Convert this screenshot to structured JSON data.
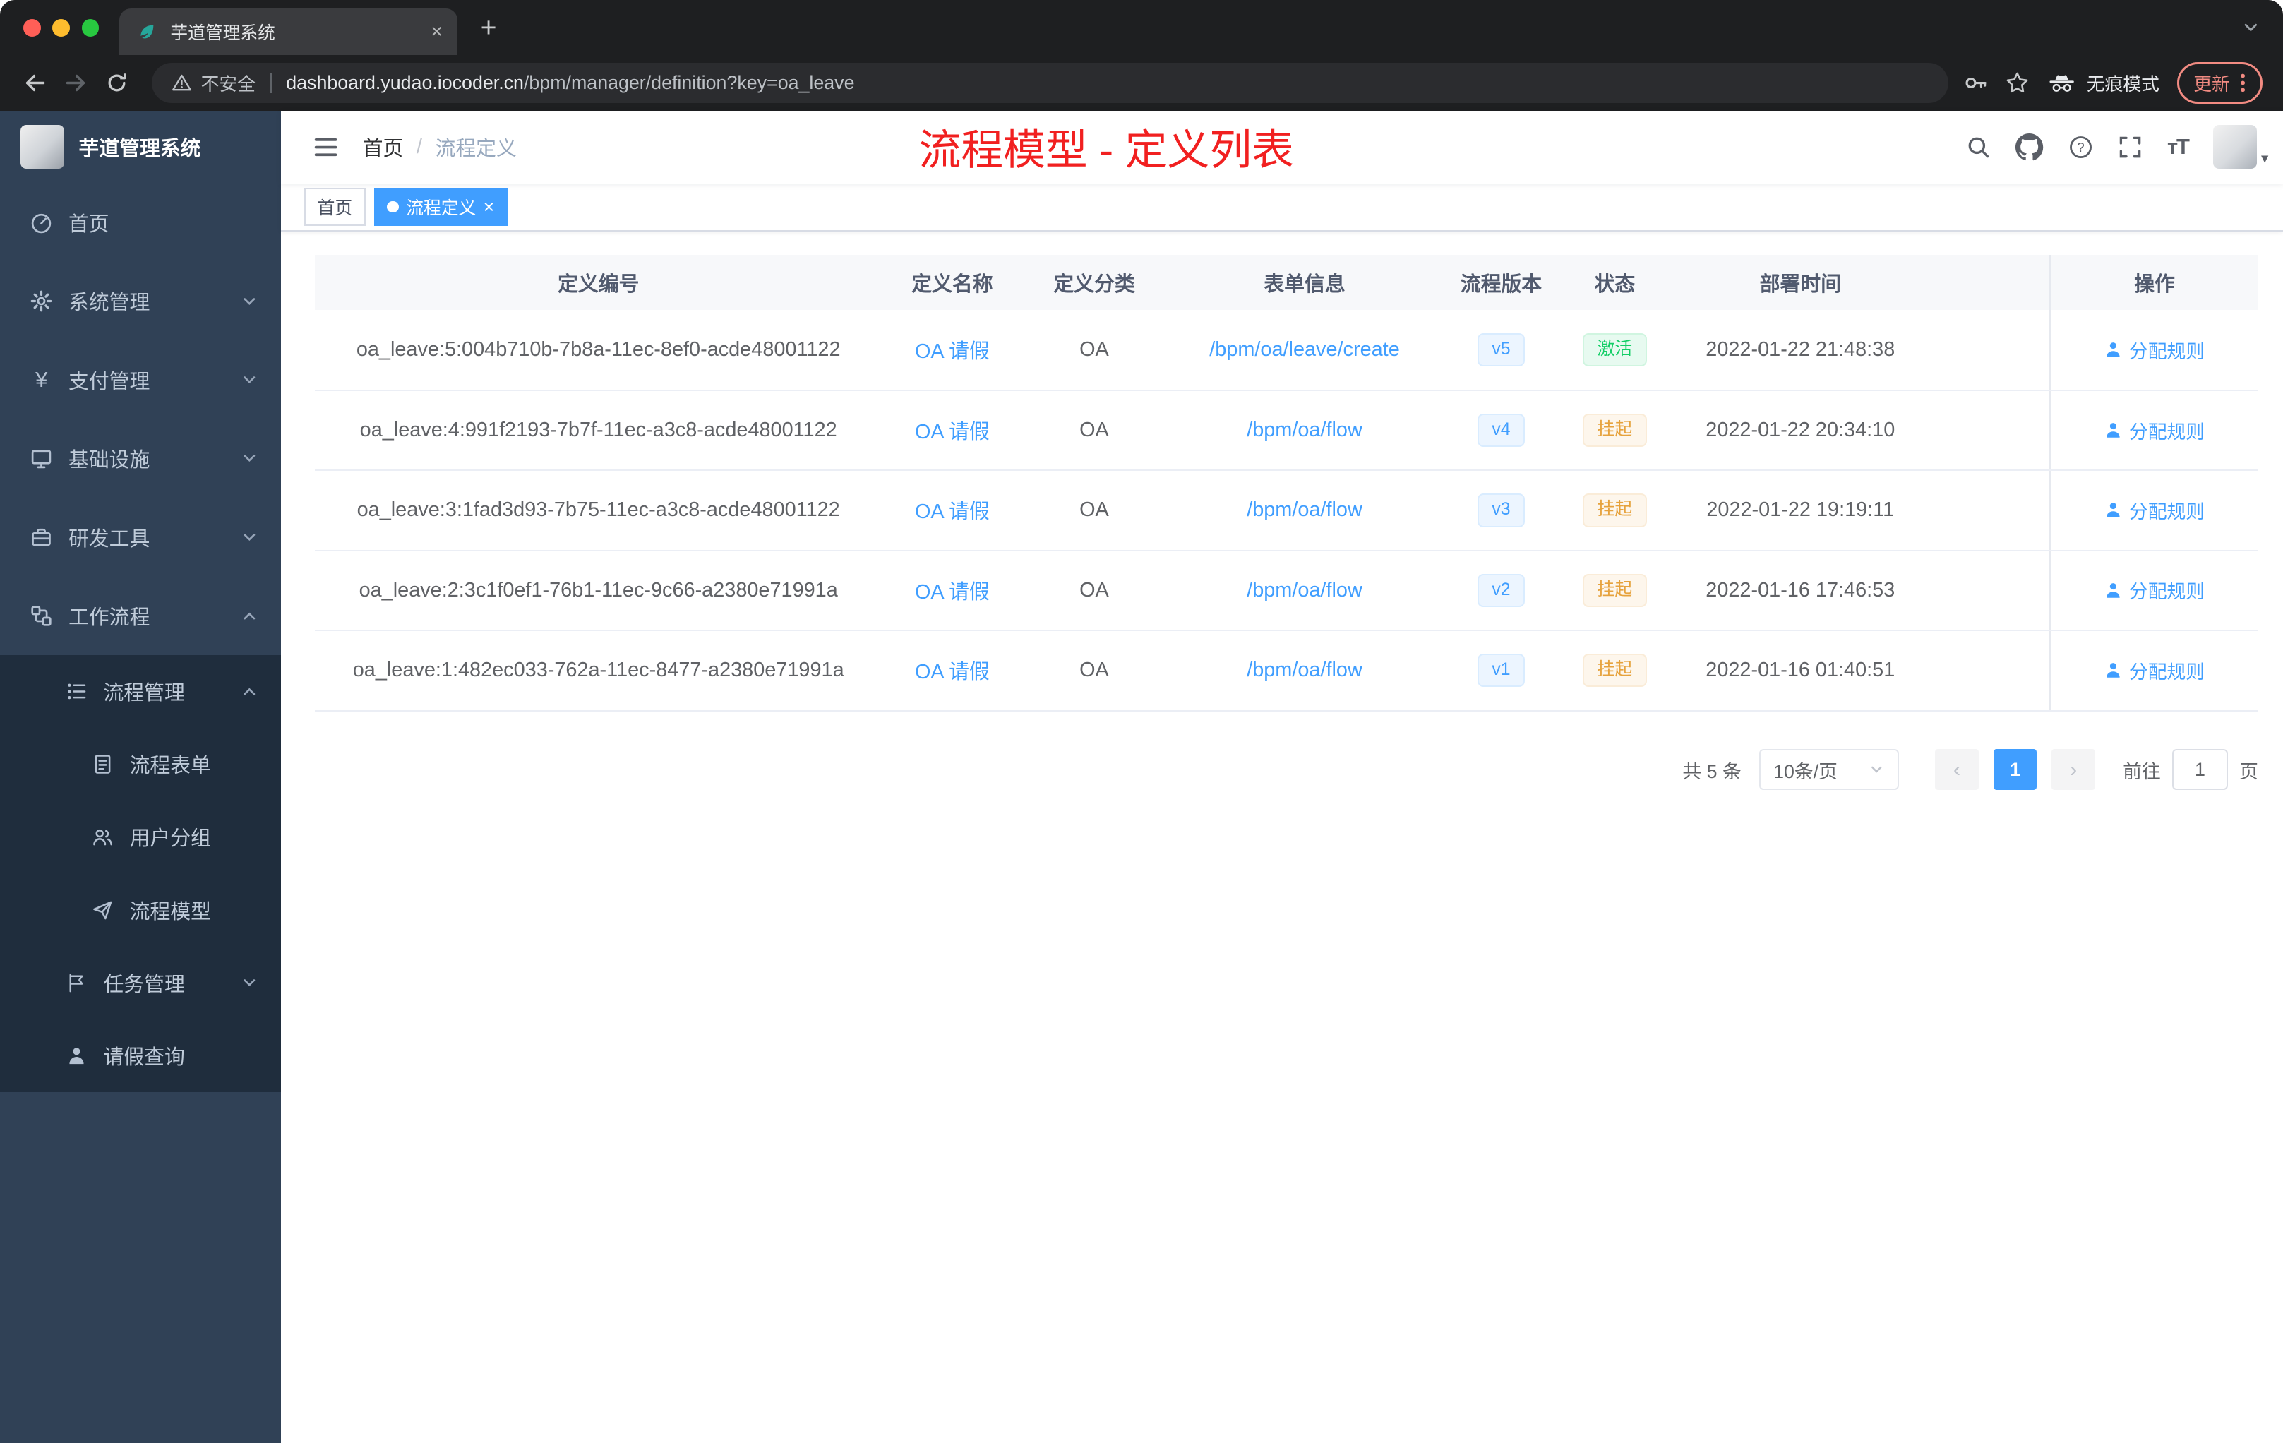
{
  "browser": {
    "tab_title": "芋道管理系统",
    "security_label": "不安全",
    "url_domain": "dashboard.yudao.iocoder.cn",
    "url_path": "/bpm/manager/definition?key=oa_leave",
    "incognito_label": "无痕模式",
    "update_label": "更新"
  },
  "sidebar": {
    "logo_title": "芋道管理系统",
    "items": [
      {
        "label": "首页",
        "icon": "dashboard-icon"
      },
      {
        "label": "系统管理",
        "icon": "gear-icon"
      },
      {
        "label": "支付管理",
        "icon": "yen-icon"
      },
      {
        "label": "基础设施",
        "icon": "monitor-icon"
      },
      {
        "label": "研发工具",
        "icon": "toolbox-icon"
      },
      {
        "label": "工作流程",
        "icon": "workflow-icon"
      },
      {
        "label": "流程管理",
        "icon": "tree-list-icon"
      },
      {
        "label": "流程表单",
        "icon": "form-icon"
      },
      {
        "label": "用户分组",
        "icon": "user-group-icon"
      },
      {
        "label": "流程模型",
        "icon": "paper-plane-icon"
      },
      {
        "label": "任务管理",
        "icon": "flag-icon"
      },
      {
        "label": "请假查询",
        "icon": "person-icon"
      }
    ]
  },
  "header": {
    "breadcrumb_home": "首页",
    "breadcrumb_current": "流程定义",
    "annotation": "流程模型 - 定义列表"
  },
  "tags": {
    "home": "首页",
    "current": "流程定义"
  },
  "table": {
    "columns": [
      "定义编号",
      "定义名称",
      "定义分类",
      "表单信息",
      "流程版本",
      "状态",
      "部署时间",
      "操作"
    ],
    "rows": [
      {
        "id": "oa_leave:5:004b710b-7b8a-11ec-8ef0-acde48001122",
        "name": "OA 请假",
        "category": "OA",
        "form": "/bpm/oa/leave/create",
        "version": "v5",
        "status": "激活",
        "time": "2022-01-22 21:48:38",
        "action": "分配规则"
      },
      {
        "id": "oa_leave:4:991f2193-7b7f-11ec-a3c8-acde48001122",
        "name": "OA 请假",
        "category": "OA",
        "form": "/bpm/oa/flow",
        "version": "v4",
        "status": "挂起",
        "time": "2022-01-22 20:34:10",
        "action": "分配规则"
      },
      {
        "id": "oa_leave:3:1fad3d93-7b75-11ec-a3c8-acde48001122",
        "name": "OA 请假",
        "category": "OA",
        "form": "/bpm/oa/flow",
        "version": "v3",
        "status": "挂起",
        "time": "2022-01-22 19:19:11",
        "action": "分配规则"
      },
      {
        "id": "oa_leave:2:3c1f0ef1-76b1-11ec-9c66-a2380e71991a",
        "name": "OA 请假",
        "category": "OA",
        "form": "/bpm/oa/flow",
        "version": "v2",
        "status": "挂起",
        "time": "2022-01-16 17:46:53",
        "action": "分配规则"
      },
      {
        "id": "oa_leave:1:482ec033-762a-11ec-8477-a2380e71991a",
        "name": "OA 请假",
        "category": "OA",
        "form": "/bpm/oa/flow",
        "version": "v1",
        "status": "挂起",
        "time": "2022-01-16 01:40:51",
        "action": "分配规则"
      }
    ]
  },
  "pagination": {
    "total": "共 5 条",
    "page_size": "10条/页",
    "current_page": "1",
    "goto_label": "前往",
    "goto_value": "1",
    "goto_unit": "页"
  },
  "colors": {
    "accent_blue": "#409eff",
    "annotation_red": "#f12020",
    "status_active_green": "#13ce66",
    "status_suspended_orange": "#e6a23c",
    "sidebar_bg": "#304156",
    "sidebar_submenu_bg": "#1f2d3d"
  }
}
